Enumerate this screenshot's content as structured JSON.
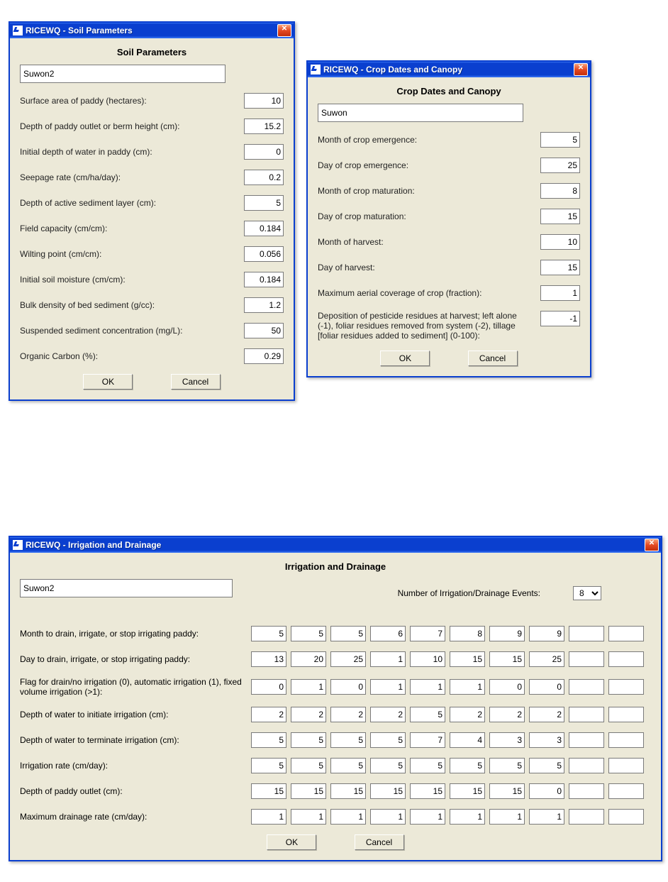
{
  "soil": {
    "title": "RICEWQ - Soil Parameters",
    "heading": "Soil Parameters",
    "name": "Suwon2",
    "fields": [
      {
        "label": "Surface area of paddy (hectares):",
        "value": "10"
      },
      {
        "label": "Depth of paddy outlet or berm height (cm):",
        "value": "15.2"
      },
      {
        "label": "Initial depth of water in paddy (cm):",
        "value": "0"
      },
      {
        "label": "Seepage rate (cm/ha/day):",
        "value": "0.2"
      },
      {
        "label": "Depth of active sediment layer (cm):",
        "value": "5"
      },
      {
        "label": "Field capacity (cm/cm):",
        "value": "0.184"
      },
      {
        "label": "Wilting point (cm/cm):",
        "value": "0.056"
      },
      {
        "label": "Initial soil moisture (cm/cm):",
        "value": "0.184"
      },
      {
        "label": "Bulk density of bed sediment (g/cc):",
        "value": "1.2"
      },
      {
        "label": "Suspended sediment concentration (mg/L):",
        "value": "50"
      },
      {
        "label": "Organic Carbon (%):",
        "value": "0.29"
      }
    ],
    "ok": "OK",
    "cancel": "Cancel"
  },
  "crop": {
    "title": "RICEWQ - Crop Dates and Canopy",
    "heading": "Crop Dates and Canopy",
    "name": "Suwon",
    "fields": [
      {
        "label": "Month of crop emergence:",
        "value": "5"
      },
      {
        "label": "Day of crop emergence:",
        "value": "25"
      },
      {
        "label": "Month of crop maturation:",
        "value": "8"
      },
      {
        "label": "Day of crop maturation:",
        "value": "15"
      },
      {
        "label": "Month of harvest:",
        "value": "10"
      },
      {
        "label": "Day of harvest:",
        "value": "15"
      },
      {
        "label": "Maximum aerial coverage of crop (fraction):",
        "value": "1"
      },
      {
        "label": "Deposition of pesticide residues at harvest; left alone (-1), foliar residues removed from system (-2), tillage [foliar residues added to sediment] (0-100):",
        "value": "-1"
      }
    ],
    "ok": "OK",
    "cancel": "Cancel"
  },
  "irr": {
    "title": "RICEWQ - Irrigation and Drainage",
    "heading": "Irrigation and Drainage",
    "name": "Suwon2",
    "events_label": "Number of Irrigation/Drainage Events:",
    "events_value": "8",
    "num_cols": 10,
    "rows": [
      {
        "label": "Month to drain, irrigate, or stop irrigating paddy:",
        "values": [
          "5",
          "5",
          "5",
          "6",
          "7",
          "8",
          "9",
          "9",
          "",
          ""
        ]
      },
      {
        "label": "Day to drain, irrigate, or stop irrigating paddy:",
        "values": [
          "13",
          "20",
          "25",
          "1",
          "10",
          "15",
          "15",
          "25",
          "",
          ""
        ]
      },
      {
        "label": "Flag for drain/no irrigation (0), automatic irrigation (1), fixed volume irrigation (>1):",
        "values": [
          "0",
          "1",
          "0",
          "1",
          "1",
          "1",
          "0",
          "0",
          "",
          ""
        ]
      },
      {
        "label": "Depth of water to initiate irrigation (cm):",
        "values": [
          "2",
          "2",
          "2",
          "2",
          "5",
          "2",
          "2",
          "2",
          "",
          ""
        ]
      },
      {
        "label": "Depth of water to terminate irrigation (cm):",
        "values": [
          "5",
          "5",
          "5",
          "5",
          "7",
          "4",
          "3",
          "3",
          "",
          ""
        ]
      },
      {
        "label": "Irrigation rate (cm/day):",
        "values": [
          "5",
          "5",
          "5",
          "5",
          "5",
          "5",
          "5",
          "5",
          "",
          ""
        ]
      },
      {
        "label": "Depth of paddy outlet (cm):",
        "values": [
          "15",
          "15",
          "15",
          "15",
          "15",
          "15",
          "15",
          "0",
          "",
          ""
        ]
      },
      {
        "label": "Maximum drainage rate (cm/day):",
        "values": [
          "1",
          "1",
          "1",
          "1",
          "1",
          "1",
          "1",
          "1",
          "",
          ""
        ]
      }
    ],
    "ok": "OK",
    "cancel": "Cancel"
  }
}
